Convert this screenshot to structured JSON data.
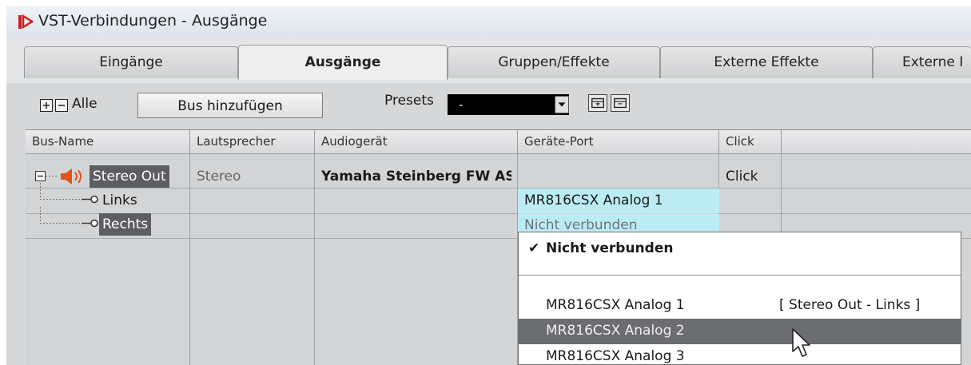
{
  "window": {
    "title": "VST-Verbindungen - Ausgänge",
    "icon": "cubase-logo-icon"
  },
  "tabs": [
    {
      "label": "Eingänge",
      "active": false
    },
    {
      "label": "Ausgänge",
      "active": true
    },
    {
      "label": "Gruppen/Effekte",
      "active": false
    },
    {
      "label": "Externe Effekte",
      "active": false
    },
    {
      "label": "Externe I",
      "active": false
    }
  ],
  "toolbar": {
    "all_label": "Alle",
    "add_bus_label": "Bus hinzufügen",
    "presets_label": "Presets",
    "presets_value": "-"
  },
  "table": {
    "headers": [
      "Bus-Name",
      "Lautsprecher",
      "Audiogerät",
      "Geräte-Port",
      "Click"
    ],
    "rows": [
      {
        "bus": "Stereo Out",
        "speaker": "Stereo",
        "device": "Yamaha Steinberg FW AS",
        "port": "",
        "click": "Click"
      },
      {
        "bus": "Links",
        "speaker": "",
        "device": "",
        "port": "MR816CSX Analog 1",
        "click": ""
      },
      {
        "bus": "Rechts",
        "speaker": "",
        "device": "",
        "port": "Nicht verbunden",
        "click": ""
      }
    ]
  },
  "dropdown": {
    "checked_item": "Nicht verbunden",
    "items": [
      {
        "label": "MR816CSX Analog 1",
        "assignment": "[ Stereo Out - Links ]"
      },
      {
        "label": "MR816CSX Analog 2",
        "assignment": ""
      },
      {
        "label": "MR816CSX Analog 3",
        "assignment": ""
      }
    ],
    "selected_index": 1
  },
  "colors": {
    "panel": "#d6d7d8",
    "port_highlight": "#bcecf3",
    "selection": "#5d5e61",
    "logo": "#c8201e"
  }
}
